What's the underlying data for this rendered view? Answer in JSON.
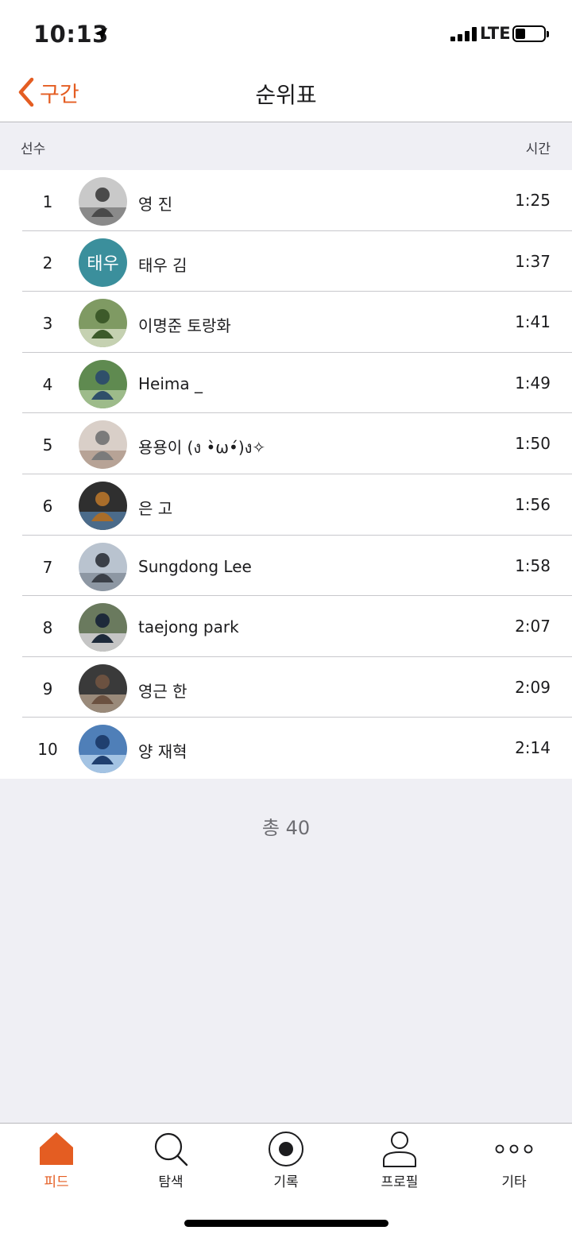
{
  "status": {
    "time": "10:13",
    "network": "LTE",
    "battery_level": 0.35
  },
  "nav": {
    "back_label": "구간",
    "title": "순위표"
  },
  "table_header": {
    "athlete": "선수",
    "time": "시간"
  },
  "leaderboard": [
    {
      "rank": "1",
      "name": "영 진",
      "time": "1:25",
      "avatar": "photo"
    },
    {
      "rank": "2",
      "name": "태우 김",
      "time": "1:37",
      "avatar": "initials",
      "initials": "태우"
    },
    {
      "rank": "3",
      "name": "이명준 토랑화",
      "time": "1:41",
      "avatar": "photo"
    },
    {
      "rank": "4",
      "name": "Heima _",
      "time": "1:49",
      "avatar": "photo"
    },
    {
      "rank": "5",
      "name": "용용이 (ง •̀ω•́)ง✧",
      "time": "1:50",
      "avatar": "photo"
    },
    {
      "rank": "6",
      "name": "은 고",
      "time": "1:56",
      "avatar": "photo"
    },
    {
      "rank": "7",
      "name": "Sungdong Lee",
      "time": "1:58",
      "avatar": "photo"
    },
    {
      "rank": "8",
      "name": "taejong park",
      "time": "2:07",
      "avatar": "photo"
    },
    {
      "rank": "9",
      "name": "영근 한",
      "time": "2:09",
      "avatar": "photo"
    },
    {
      "rank": "10",
      "name": "양 재혁",
      "time": "2:14",
      "avatar": "photo"
    }
  ],
  "total_label": "총 40",
  "tabs": [
    {
      "label": "피드",
      "icon": "home-icon",
      "active": true
    },
    {
      "label": "탐색",
      "icon": "search-icon",
      "active": false
    },
    {
      "label": "기록",
      "icon": "record-icon",
      "active": false
    },
    {
      "label": "프로필",
      "icon": "profile-icon",
      "active": false
    },
    {
      "label": "기타",
      "icon": "more-icon",
      "active": false
    }
  ],
  "colors": {
    "accent": "#e45d22",
    "initials_bg": "#3b8f9c",
    "background": "#efeff4"
  }
}
